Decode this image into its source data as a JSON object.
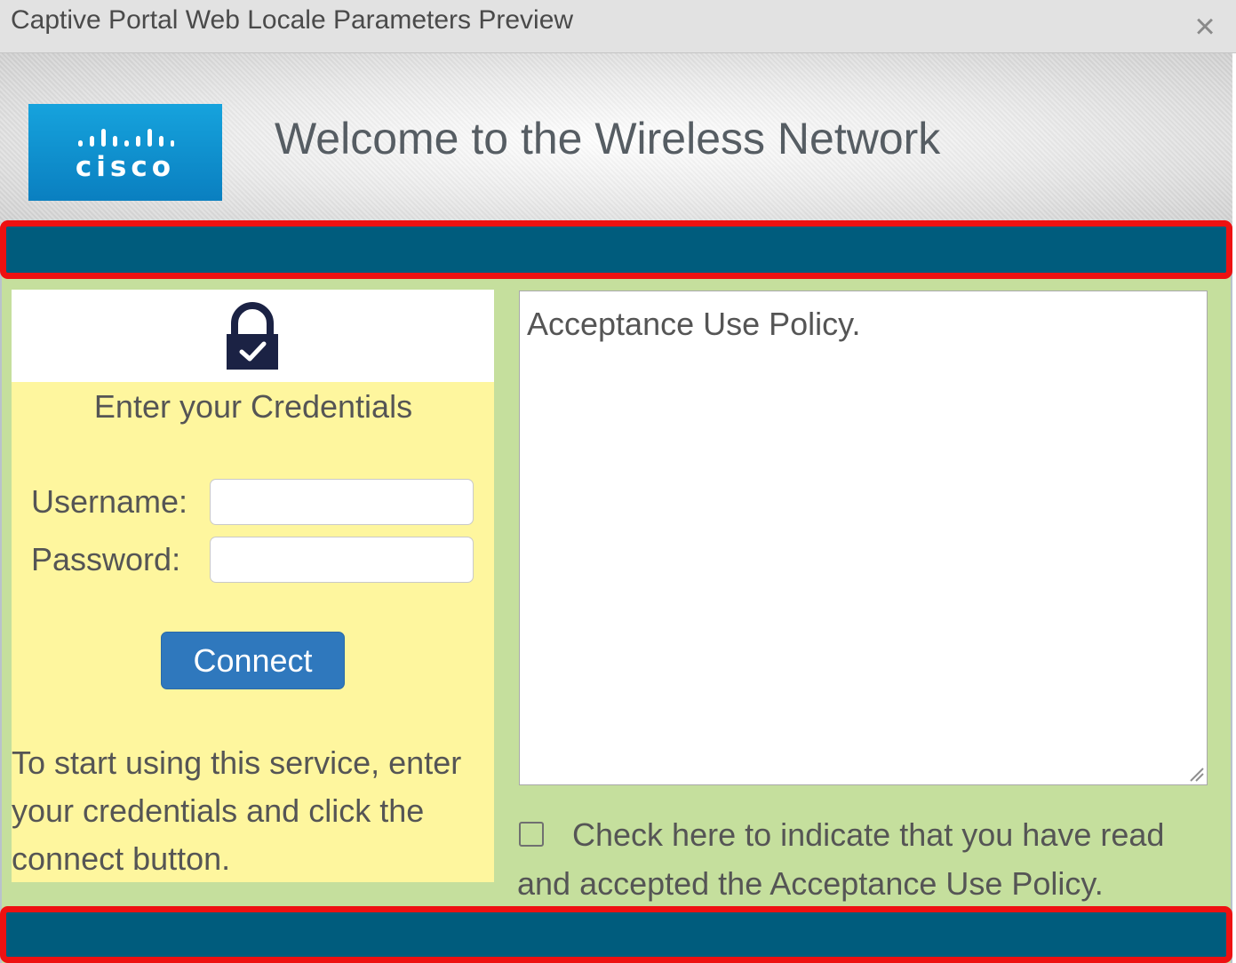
{
  "dialog": {
    "title": "Captive Portal Web Locale Parameters Preview",
    "close_glyph": "×"
  },
  "banner": {
    "logo_text": "cisco",
    "welcome": "Welcome to the Wireless Network"
  },
  "login": {
    "heading": "Enter your Credentials",
    "username_label": "Username:",
    "username_value": "",
    "password_label": "Password:",
    "password_value": "",
    "connect_label": "Connect",
    "instructions": "To start using this service, enter your credentials and click the connect button."
  },
  "policy": {
    "text": "Acceptance Use Policy.",
    "agree_label": "Check here to indicate that you have read and accepted the Acceptance Use Policy.",
    "agree_checked": false
  },
  "colors": {
    "bar": "#005c7d",
    "highlight": "#ee1111",
    "login_bg": "#fef69e",
    "page_bg": "#c5df9d",
    "button": "#2f78bd",
    "logo": "#0a7fc0"
  },
  "icons": {
    "lock": "lock-check-icon",
    "close": "close-icon",
    "resize": "resize-grip-icon",
    "logo": "cisco-logo"
  }
}
